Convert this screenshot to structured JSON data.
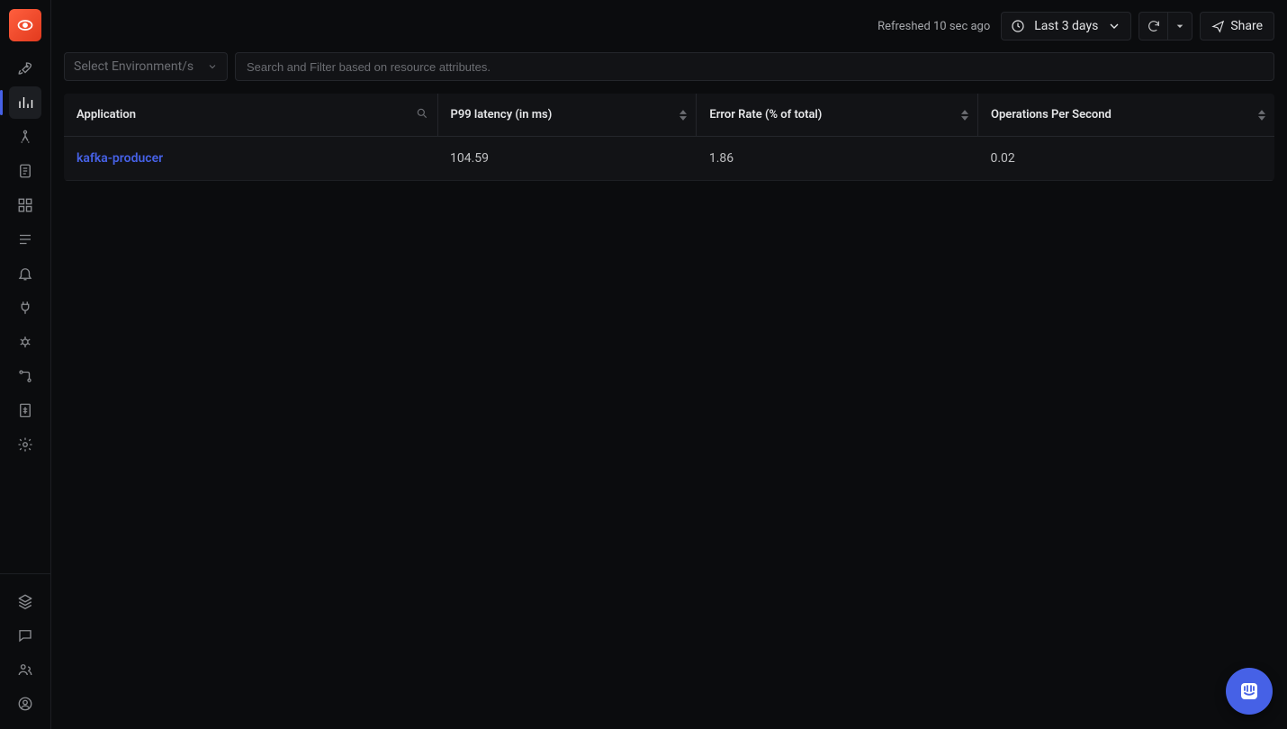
{
  "topbar": {
    "refreshed_label": "Refreshed 10 sec ago",
    "time_range_label": "Last 3 days",
    "share_label": "Share"
  },
  "filters": {
    "env_placeholder": "Select Environment/s",
    "search_placeholder": "Search and Filter based on resource attributes."
  },
  "table": {
    "columns": {
      "application": "Application",
      "p99": "P99 latency (in ms)",
      "error_rate": "Error Rate (% of total)",
      "ops": "Operations Per Second"
    },
    "rows": [
      {
        "application": "kafka-producer",
        "p99": "104.59",
        "error_rate": "1.86",
        "ops": "0.02"
      }
    ]
  },
  "icons": {
    "logo": "signoz-logo",
    "nav": [
      "rocket",
      "chart",
      "trace",
      "logs",
      "dashboards",
      "messaging",
      "alerts",
      "integrations",
      "exceptions",
      "services",
      "billing",
      "settings"
    ],
    "nav_bottom": [
      "layers",
      "chat",
      "users",
      "profile"
    ]
  }
}
